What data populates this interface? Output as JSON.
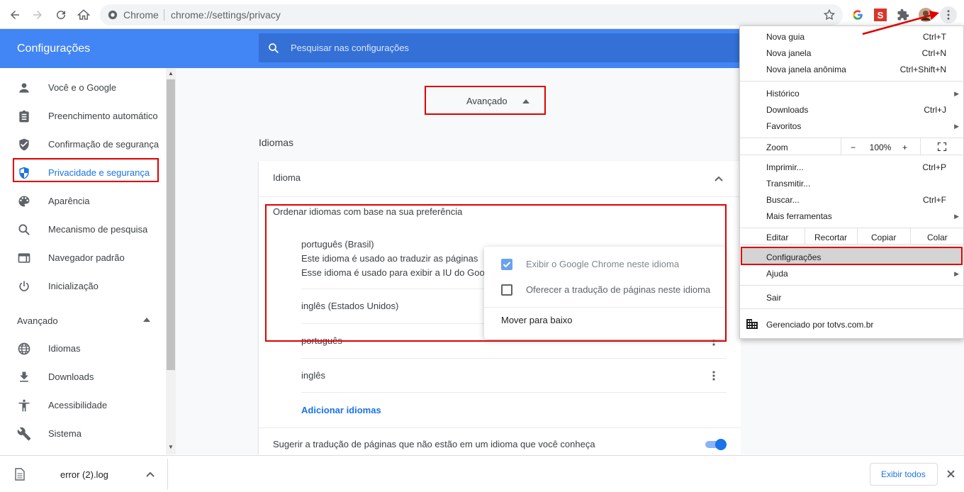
{
  "browser": {
    "omnibox_label": "Chrome",
    "url": "chrome://settings/privacy"
  },
  "header": {
    "title": "Configurações",
    "search_placeholder": "Pesquisar nas configurações"
  },
  "sidebar": {
    "items": [
      {
        "label": "Você e o Google",
        "icon": "person-icon"
      },
      {
        "label": "Preenchimento automático",
        "icon": "clipboard-icon"
      },
      {
        "label": "Confirmação de segurança",
        "icon": "shield-check-icon"
      },
      {
        "label": "Privacidade e segurança",
        "icon": "shield-icon"
      },
      {
        "label": "Aparência",
        "icon": "palette-icon"
      },
      {
        "label": "Mecanismo de pesquisa",
        "icon": "search-icon"
      },
      {
        "label": "Navegador padrão",
        "icon": "browser-icon"
      },
      {
        "label": "Inicialização",
        "icon": "power-icon"
      }
    ],
    "advanced_label": "Avançado",
    "advanced_items": [
      {
        "label": "Idiomas",
        "icon": "globe-icon"
      },
      {
        "label": "Downloads",
        "icon": "download-icon"
      },
      {
        "label": "Acessibilidade",
        "icon": "accessibility-icon"
      },
      {
        "label": "Sistema",
        "icon": "wrench-icon"
      }
    ]
  },
  "main": {
    "advanced_button": "Avançado",
    "section_title": "Idiomas",
    "card": {
      "header": "Idioma",
      "order_label": "Ordenar idiomas com base na sua preferência",
      "languages": [
        {
          "name": "português (Brasil)",
          "notes": [
            "Este idioma é usado ao traduzir as páginas",
            "Esse idioma é usado para exibir a IU do Google Chrome"
          ]
        },
        {
          "name": "inglês (Estados Unidos)"
        },
        {
          "name": "português"
        },
        {
          "name": "inglês"
        }
      ],
      "add_languages": "Adicionar idiomas",
      "suggest_translation": "Sugerir a tradução de páginas que não estão em um idioma que você conheça",
      "suggest_translation_on": true
    },
    "popup": {
      "display_chrome": "Exibir o Google Chrome neste idioma",
      "display_chrome_checked": true,
      "offer_translate": "Oferecer a tradução de páginas neste idioma",
      "offer_translate_checked": false,
      "move_down": "Mover para baixo"
    }
  },
  "chrome_menu": {
    "new_tab": "Nova guia",
    "new_tab_sc": "Ctrl+T",
    "new_window": "Nova janela",
    "new_window_sc": "Ctrl+N",
    "incognito": "Nova janela anônima",
    "incognito_sc": "Ctrl+Shift+N",
    "history": "Histórico",
    "downloads": "Downloads",
    "downloads_sc": "Ctrl+J",
    "bookmarks": "Favoritos",
    "zoom": "Zoom",
    "zoom_minus": "−",
    "zoom_level": "100%",
    "zoom_plus": "+",
    "print": "Imprimir...",
    "print_sc": "Ctrl+P",
    "cast": "Transmitir...",
    "find": "Buscar...",
    "find_sc": "Ctrl+F",
    "more_tools": "Mais ferramentas",
    "edit": "Editar",
    "cut": "Recortar",
    "copy": "Copiar",
    "paste": "Colar",
    "settings": "Configurações",
    "help": "Ajuda",
    "exit": "Sair",
    "managed": "Gerenciado por totvs.com.br"
  },
  "download_bar": {
    "filename": "error (2).log",
    "show_all": "Exibir todos"
  },
  "colors": {
    "accent": "#4285f4",
    "highlight": "#e00000",
    "link": "#1a73e8"
  }
}
